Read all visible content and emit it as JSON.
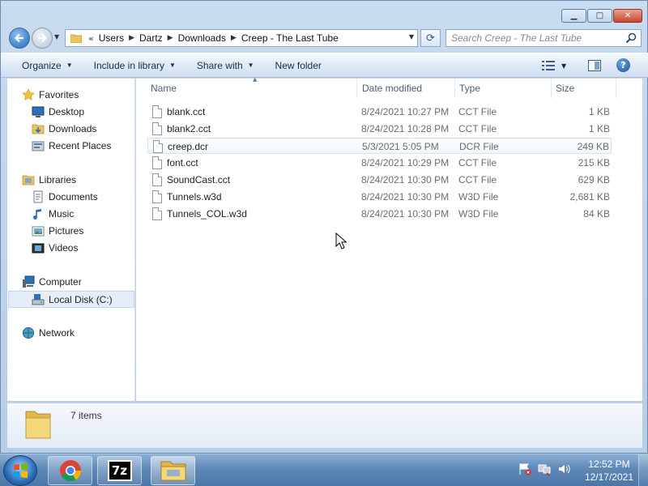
{
  "address": {
    "overflow": "«",
    "crumbs": [
      "Users",
      "Dartz",
      "Downloads",
      "Creep - The Last Tube"
    ]
  },
  "search": {
    "placeholder": "Search Creep - The Last Tube"
  },
  "toolbar": {
    "organize": "Organize",
    "include_in_library": "Include in library",
    "share_with": "Share with",
    "new_folder": "New folder"
  },
  "nav": {
    "favorites": "Favorites",
    "desktop": "Desktop",
    "downloads": "Downloads",
    "recent_places": "Recent Places",
    "libraries": "Libraries",
    "documents": "Documents",
    "music": "Music",
    "pictures": "Pictures",
    "videos": "Videos",
    "computer": "Computer",
    "local_disk": "Local Disk (C:)",
    "network": "Network"
  },
  "columns": {
    "name": "Name",
    "date_modified": "Date modified",
    "type": "Type",
    "size": "Size"
  },
  "files": [
    {
      "name": "blank.cct",
      "date": "8/24/2021 10:27 PM",
      "type": "CCT File",
      "size": "1 KB"
    },
    {
      "name": "blank2.cct",
      "date": "8/24/2021 10:28 PM",
      "type": "CCT File",
      "size": "1 KB"
    },
    {
      "name": "creep.dcr",
      "date": "5/3/2021 5:05 PM",
      "type": "DCR File",
      "size": "249 KB"
    },
    {
      "name": "font.cct",
      "date": "8/24/2021 10:29 PM",
      "type": "CCT File",
      "size": "215 KB"
    },
    {
      "name": "SoundCast.cct",
      "date": "8/24/2021 10:30 PM",
      "type": "CCT File",
      "size": "629 KB"
    },
    {
      "name": "Tunnels.w3d",
      "date": "8/24/2021 10:30 PM",
      "type": "W3D File",
      "size": "2,681 KB"
    },
    {
      "name": "Tunnels_COL.w3d",
      "date": "8/24/2021 10:30 PM",
      "type": "W3D File",
      "size": "84 KB"
    }
  ],
  "details": {
    "item_count": "7 items"
  },
  "taskbar": {
    "time": "12:52 PM",
    "date": "12/17/2021",
    "sevenzip_label": "7z"
  },
  "colors": {
    "accent": "#3a6aa5",
    "selection": "#e5eef8",
    "taskbar": "#5d87b6"
  }
}
